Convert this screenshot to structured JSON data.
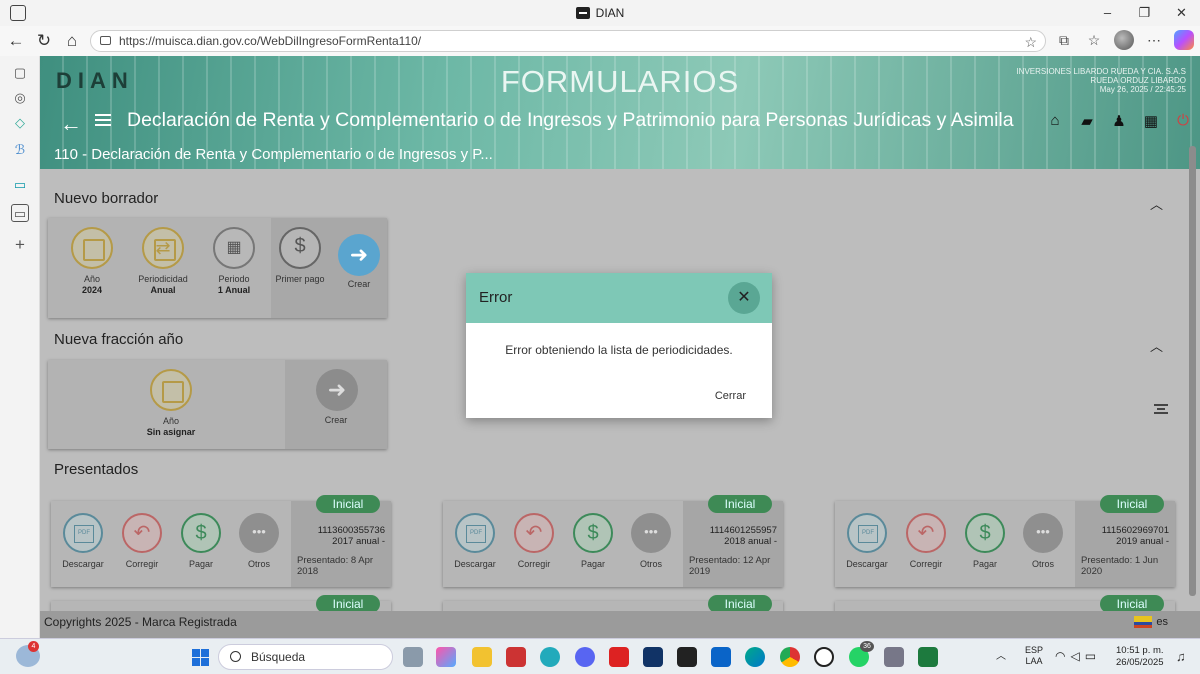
{
  "window": {
    "title": "DIAN",
    "controls": [
      "–",
      "❐",
      "✕"
    ]
  },
  "browser": {
    "url": "https://muisca.dian.gov.co/WebDilIngresoFormRenta110/"
  },
  "header": {
    "logo": "DIAN",
    "title": "FORMULARIOS",
    "company_line1": "INVERSIONES LIBARDO RUEDA Y CIA. S.A.S",
    "company_line2": "RUEDA ORDUZ LIBARDO",
    "datetime": "May 26, 2025 / 22:45:25",
    "declaration": "Declaración de Renta y Complementario o de Ingresos y Patrimonio para Personas Jurídicas y Asimila",
    "breadcrumb": "110 - Declaración de Renta y Complementario o de Ingresos y P..."
  },
  "nuevo_borrador": {
    "title": "Nuevo borrador",
    "items": [
      {
        "label": "Año",
        "value": "2024"
      },
      {
        "label": "Periodicidad",
        "value": "Anual"
      },
      {
        "label": "Periodo",
        "value": "1 Anual"
      },
      {
        "label": "Primer pago",
        "value": ""
      }
    ],
    "create": "Crear"
  },
  "nueva_fraccion": {
    "title": "Nueva fracción año",
    "item": {
      "label": "Año",
      "value": "Sin asignar"
    },
    "create": "Crear"
  },
  "presentados": {
    "title": "Presentados",
    "actions": [
      "Descargar",
      "Corregir",
      "Pagar",
      "Otros"
    ],
    "cards": [
      {
        "badge": "Inicial",
        "number": "1113600355736",
        "desc": "2017 anual -",
        "presented": "Presentado: 8 Apr 2018"
      },
      {
        "badge": "Inicial",
        "number": "1114601255957",
        "desc": "2018 anual -",
        "presented": "Presentado: 12 Apr 2019"
      },
      {
        "badge": "Inicial",
        "number": "1115602969701",
        "desc": "2019 anual -",
        "presented": "Presentado: 1 Jun 2020"
      }
    ],
    "second_row_badge": "Inicial"
  },
  "footer": {
    "copyright": "Copyrights 2025 - Marca Registrada",
    "lang": "es"
  },
  "modal": {
    "title": "Error",
    "message": "Error obteniendo la lista de periodicidades.",
    "button": "Cerrar"
  },
  "taskbar": {
    "search_placeholder": "Búsqueda",
    "weather_badge": "4",
    "whatsapp_badge": "36",
    "lang_line1": "ESP",
    "lang_line2": "LAA",
    "time": "10:51 p. m.",
    "date": "26/05/2025"
  }
}
